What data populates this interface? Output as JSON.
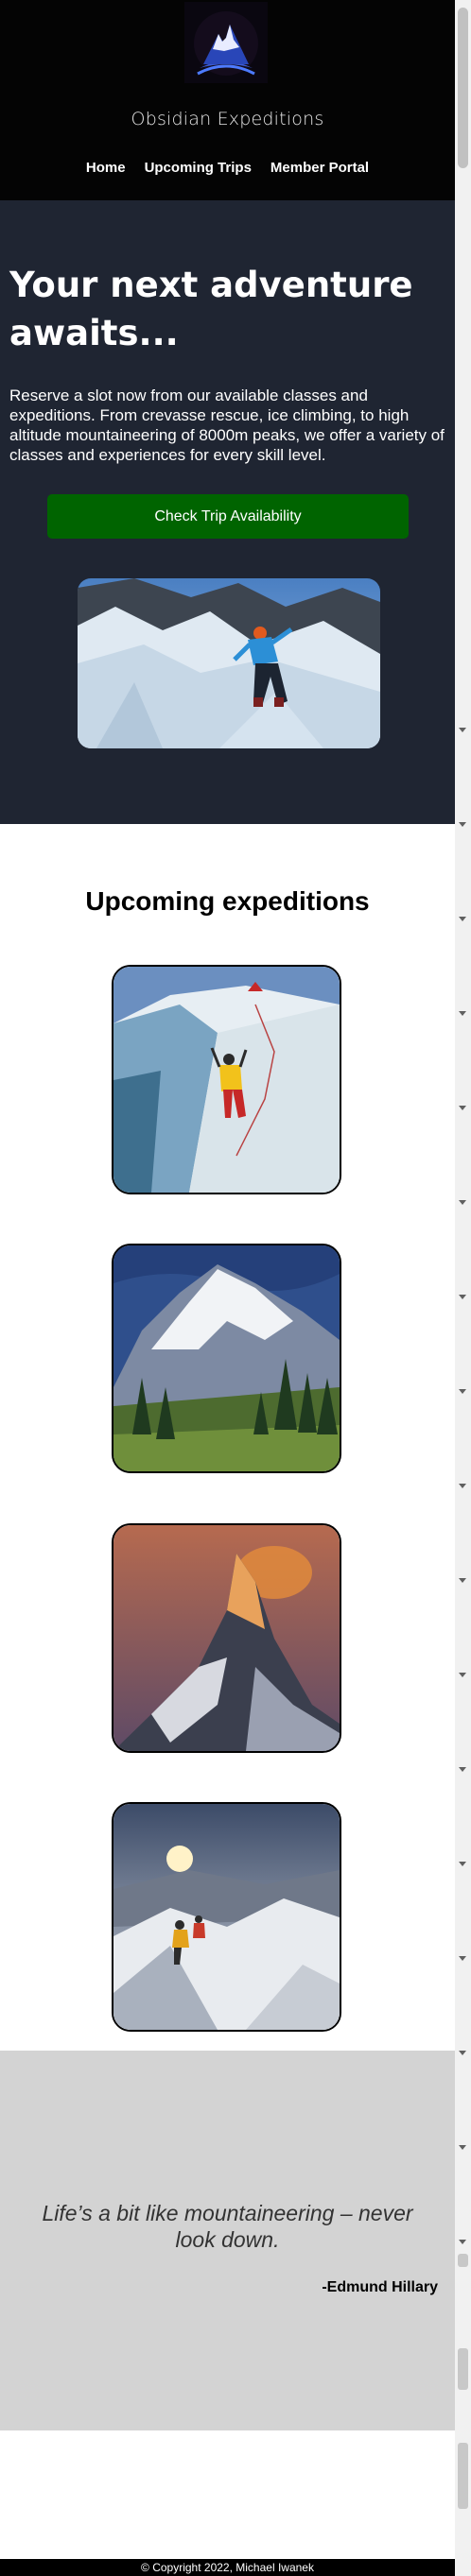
{
  "brand": {
    "name": "Obsidian Expeditions",
    "logo": "mountain-logo-icon"
  },
  "nav": {
    "items": [
      {
        "label": "Home"
      },
      {
        "label": "Upcoming Trips"
      },
      {
        "label": "Member Portal"
      }
    ]
  },
  "hero": {
    "title": "Your next adventure awaits...",
    "description": "Reserve a slot now from our available classes and expeditions. From crevasse rescue, ice climbing, to high altitude mountaineering of 8000m peaks, we offer a variety of classes and experiences for every skill level.",
    "cta_label": "Check Trip Availability",
    "image": "ice-climber-photo"
  },
  "trips": {
    "title": "Upcoming expeditions",
    "items": [
      {
        "image": "crevasse-ice-climb-photo"
      },
      {
        "image": "forested-volcano-photo"
      },
      {
        "image": "matterhorn-sunset-photo"
      },
      {
        "image": "summit-ridge-climbers-photo"
      }
    ]
  },
  "quote": {
    "text": "Life’s a bit like mountaineering – never look down.",
    "author": "-Edmund Hillary"
  },
  "footer": {
    "text": "© Copyright 2022, Michael Iwanek"
  },
  "colors": {
    "header_bg": "#040404",
    "hero_bg": "#1f2532",
    "cta_bg": "#006400",
    "quote_bg": "#d3d3d3",
    "footer_bg": "#000000"
  }
}
